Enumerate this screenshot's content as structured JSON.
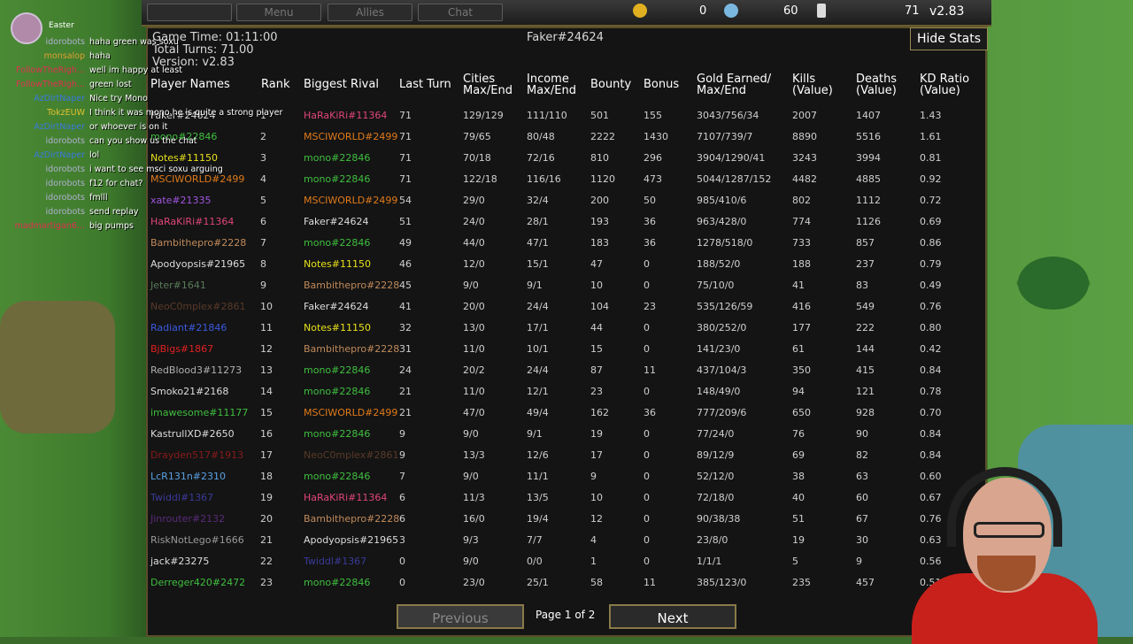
{
  "topbar": {
    "buttons": [
      "",
      "Menu",
      "Allies",
      "Chat"
    ],
    "gold": "0",
    "lumber": "60",
    "food": "71",
    "version": "v2.83"
  },
  "meta": {
    "game_time": "Game Time: 01:11:00",
    "total_turns": "Total Turns: 71.00",
    "version": "Version: v2.83",
    "player_tag": "Faker#24624",
    "hide_button": "Hide Stats"
  },
  "headers": {
    "names": "Player Names",
    "rank": "Rank",
    "rival": "Biggest Rival",
    "last_turn": "Last Turn",
    "cities_1": "Cities",
    "cities_2": "Max/End",
    "income_1": "Income",
    "income_2": "Max/End",
    "bounty": "Bounty",
    "bonus": "Bonus",
    "gold_1": "Gold Earned/",
    "gold_2": "Max/End",
    "kills_1": "Kills",
    "kills_2": "(Value)",
    "deaths_1": "Deaths",
    "deaths_2": "(Value)",
    "kd_1": "KD Ratio",
    "kd_2": "(Value)"
  },
  "rows": [
    {
      "name": "Faker#24624",
      "name_color": "#dddddd",
      "rank": "1",
      "rival": "HaRaKiRi#11364",
      "rival_color": "#e0457a",
      "last": "71",
      "cities": "129/129",
      "income": "111/110",
      "bounty": "501",
      "bonus": "155",
      "gold": "3043/756/34",
      "kills": "2007",
      "deaths": "1407",
      "kd": "1.43"
    },
    {
      "name": "mono#22846",
      "name_color": "#3fbf3f",
      "rank": "2",
      "rival": "MSCIWORLD#2499",
      "rival_color": "#e07a1a",
      "last": "71",
      "cities": "79/65",
      "income": "80/48",
      "bounty": "2222",
      "bonus": "1430",
      "gold": "7107/739/7",
      "kills": "8890",
      "deaths": "5516",
      "kd": "1.61"
    },
    {
      "name": "Notes#11150",
      "name_color": "#e6e01a",
      "rank": "3",
      "rival": "mono#22846",
      "rival_color": "#3fbf3f",
      "last": "71",
      "cities": "70/18",
      "income": "72/16",
      "bounty": "810",
      "bonus": "296",
      "gold": "3904/1290/41",
      "kills": "3243",
      "deaths": "3994",
      "kd": "0.81"
    },
    {
      "name": "MSCIWORLD#2499",
      "name_color": "#e07a1a",
      "rank": "4",
      "rival": "mono#22846",
      "rival_color": "#3fbf3f",
      "last": "71",
      "cities": "122/18",
      "income": "116/16",
      "bounty": "1120",
      "bonus": "473",
      "gold": "5044/1287/152",
      "kills": "4482",
      "deaths": "4885",
      "kd": "0.92"
    },
    {
      "name": "xate#21335",
      "name_color": "#a055e0",
      "rank": "5",
      "rival": "MSCIWORLD#2499",
      "rival_color": "#e07a1a",
      "last": "54",
      "cities": "29/0",
      "income": "32/4",
      "bounty": "200",
      "bonus": "50",
      "gold": "985/410/6",
      "kills": "802",
      "deaths": "1112",
      "kd": "0.72"
    },
    {
      "name": "HaRaKiRi#11364",
      "name_color": "#e0457a",
      "rank": "6",
      "rival": "Faker#24624",
      "rival_color": "#dddddd",
      "last": "51",
      "cities": "24/0",
      "income": "28/1",
      "bounty": "193",
      "bonus": "36",
      "gold": "963/428/0",
      "kills": "774",
      "deaths": "1126",
      "kd": "0.69"
    },
    {
      "name": "Bambithepro#2228",
      "name_color": "#c08a5a",
      "rank": "7",
      "rival": "mono#22846",
      "rival_color": "#3fbf3f",
      "last": "49",
      "cities": "44/0",
      "income": "47/1",
      "bounty": "183",
      "bonus": "36",
      "gold": "1278/518/0",
      "kills": "733",
      "deaths": "857",
      "kd": "0.86"
    },
    {
      "name": "Apodyopsis#21965",
      "name_color": "#dddddd",
      "rank": "8",
      "rival": "Notes#11150",
      "rival_color": "#e6e01a",
      "last": "46",
      "cities": "12/0",
      "income": "15/1",
      "bounty": "47",
      "bonus": "0",
      "gold": "188/52/0",
      "kills": "188",
      "deaths": "237",
      "kd": "0.79"
    },
    {
      "name": "Jeter#1641",
      "name_color": "#5a7a5a",
      "rank": "9",
      "rival": "Bambithepro#2228",
      "rival_color": "#c08a5a",
      "last": "45",
      "cities": "9/0",
      "income": "9/1",
      "bounty": "10",
      "bonus": "0",
      "gold": "75/10/0",
      "kills": "41",
      "deaths": "83",
      "kd": "0.49"
    },
    {
      "name": "NeoC0mplex#2861",
      "name_color": "#5a3a2a",
      "rank": "10",
      "rival": "Faker#24624",
      "rival_color": "#dddddd",
      "last": "41",
      "cities": "20/0",
      "income": "24/4",
      "bounty": "104",
      "bonus": "23",
      "gold": "535/126/59",
      "kills": "416",
      "deaths": "549",
      "kd": "0.76"
    },
    {
      "name": "Radiant#21846",
      "name_color": "#3a5ae0",
      "rank": "11",
      "rival": "Notes#11150",
      "rival_color": "#e6e01a",
      "last": "32",
      "cities": "13/0",
      "income": "17/1",
      "bounty": "44",
      "bonus": "0",
      "gold": "380/252/0",
      "kills": "177",
      "deaths": "222",
      "kd": "0.80"
    },
    {
      "name": "BjBigs#1867",
      "name_color": "#e02020",
      "rank": "12",
      "rival": "Bambithepro#2228",
      "rival_color": "#c08a5a",
      "last": "31",
      "cities": "11/0",
      "income": "10/1",
      "bounty": "15",
      "bonus": "0",
      "gold": "141/23/0",
      "kills": "61",
      "deaths": "144",
      "kd": "0.42"
    },
    {
      "name": "RedBlood3#11273",
      "name_color": "#b0b0b0",
      "rank": "13",
      "rival": "mono#22846",
      "rival_color": "#3fbf3f",
      "last": "24",
      "cities": "20/2",
      "income": "24/4",
      "bounty": "87",
      "bonus": "11",
      "gold": "437/104/3",
      "kills": "350",
      "deaths": "415",
      "kd": "0.84"
    },
    {
      "name": "Smoko21#2168",
      "name_color": "#dddddd",
      "rank": "14",
      "rival": "mono#22846",
      "rival_color": "#3fbf3f",
      "last": "21",
      "cities": "11/0",
      "income": "12/1",
      "bounty": "23",
      "bonus": "0",
      "gold": "148/49/0",
      "kills": "94",
      "deaths": "121",
      "kd": "0.78"
    },
    {
      "name": "imawesome#11177",
      "name_color": "#3fbf3f",
      "rank": "15",
      "rival": "MSCIWORLD#2499",
      "rival_color": "#e07a1a",
      "last": "21",
      "cities": "47/0",
      "income": "49/4",
      "bounty": "162",
      "bonus": "36",
      "gold": "777/209/6",
      "kills": "650",
      "deaths": "928",
      "kd": "0.70"
    },
    {
      "name": "KastrullXD#2650",
      "name_color": "#dddddd",
      "rank": "16",
      "rival": "mono#22846",
      "rival_color": "#3fbf3f",
      "last": "9",
      "cities": "9/0",
      "income": "9/1",
      "bounty": "19",
      "bonus": "0",
      "gold": "77/24/0",
      "kills": "76",
      "deaths": "90",
      "kd": "0.84"
    },
    {
      "name": "Drayden517#1913",
      "name_color": "#8a1a1a",
      "rank": "17",
      "rival": "NeoC0mplex#2861",
      "rival_color": "#5a3a2a",
      "last": "9",
      "cities": "13/3",
      "income": "12/6",
      "bounty": "17",
      "bonus": "0",
      "gold": "89/12/9",
      "kills": "69",
      "deaths": "82",
      "kd": "0.84"
    },
    {
      "name": "LcR131n#2310",
      "name_color": "#5aa0e0",
      "rank": "18",
      "rival": "mono#22846",
      "rival_color": "#3fbf3f",
      "last": "7",
      "cities": "9/0",
      "income": "11/1",
      "bounty": "9",
      "bonus": "0",
      "gold": "52/12/0",
      "kills": "38",
      "deaths": "63",
      "kd": "0.60"
    },
    {
      "name": "Twiddl#1367",
      "name_color": "#3a3a9a",
      "rank": "19",
      "rival": "HaRaKiRi#11364",
      "rival_color": "#e0457a",
      "last": "6",
      "cities": "11/3",
      "income": "13/5",
      "bounty": "10",
      "bonus": "0",
      "gold": "72/18/0",
      "kills": "40",
      "deaths": "60",
      "kd": "0.67"
    },
    {
      "name": "Jinrouter#2132",
      "name_color": "#5a2a7a",
      "rank": "20",
      "rival": "Bambithepro#2228",
      "rival_color": "#c08a5a",
      "last": "6",
      "cities": "16/0",
      "income": "19/4",
      "bounty": "12",
      "bonus": "0",
      "gold": "90/38/38",
      "kills": "51",
      "deaths": "67",
      "kd": "0.76"
    },
    {
      "name": "RiskNotLego#1666",
      "name_color": "#9a9a9a",
      "rank": "21",
      "rival": "Apodyopsis#21965",
      "rival_color": "#dddddd",
      "last": "3",
      "cities": "9/3",
      "income": "7/7",
      "bounty": "4",
      "bonus": "0",
      "gold": "23/8/0",
      "kills": "19",
      "deaths": "30",
      "kd": "0.63"
    },
    {
      "name": "jack#23275",
      "name_color": "#dddddd",
      "rank": "22",
      "rival": "Twiddl#1367",
      "rival_color": "#3a3a9a",
      "last": "0",
      "cities": "9/0",
      "income": "0/0",
      "bounty": "1",
      "bonus": "0",
      "gold": "1/1/1",
      "kills": "5",
      "deaths": "9",
      "kd": "0.56"
    },
    {
      "name": "Derreger420#2472",
      "name_color": "#3fbf3f",
      "rank": "23",
      "rival": "mono#22846",
      "rival_color": "#3fbf3f",
      "last": "0",
      "cities": "23/0",
      "income": "25/1",
      "bounty": "58",
      "bonus": "11",
      "gold": "385/123/0",
      "kills": "235",
      "deaths": "457",
      "kd": "0.51"
    }
  ],
  "footer": {
    "previous": "Previous",
    "page": "Page 1 of 2",
    "next": "Next"
  },
  "chat": {
    "easter": "Easter",
    "lines": [
      {
        "user": "idorobots",
        "color": "#b0b0d0",
        "msg": "haha green was soxu"
      },
      {
        "user": "monsalop",
        "color": "#e0a030",
        "msg": "haha"
      },
      {
        "user": "FollowTheRigh...",
        "color": "#e03050",
        "msg": "well im happy at least"
      },
      {
        "user": "FollowTheRigh...",
        "color": "#e03050",
        "msg": "green lost"
      },
      {
        "user": "AzDirtNaper",
        "color": "#3a7ae0",
        "msg": "Nice try Mono"
      },
      {
        "user": "TokzEUW",
        "color": "#e0c030",
        "msg": "I think it was mono he is quite a strong player"
      },
      {
        "user": "AzDirtNaper",
        "color": "#3a7ae0",
        "msg": "or whoever is on it"
      },
      {
        "user": "idorobots",
        "color": "#b0b0d0",
        "msg": "can you show us the chat"
      },
      {
        "user": "AzDirtNaper",
        "color": "#3a7ae0",
        "msg": "lol"
      },
      {
        "user": "idorobots",
        "color": "#b0b0d0",
        "msg": "i want to see msci soxu arguing"
      },
      {
        "user": "idorobots",
        "color": "#b0b0d0",
        "msg": "f12 for chat?"
      },
      {
        "user": "idorobots",
        "color": "#b0b0d0",
        "msg": "fmlll"
      },
      {
        "user": "idorobots",
        "color": "#b0b0d0",
        "msg": "send replay"
      },
      {
        "user": "madmartigan6...",
        "color": "#e03050",
        "msg": "big pumps"
      }
    ]
  },
  "icons": {
    "gold": "gold-coin-icon",
    "lumber": "lumber-icon",
    "food": "hourglass-icon"
  }
}
